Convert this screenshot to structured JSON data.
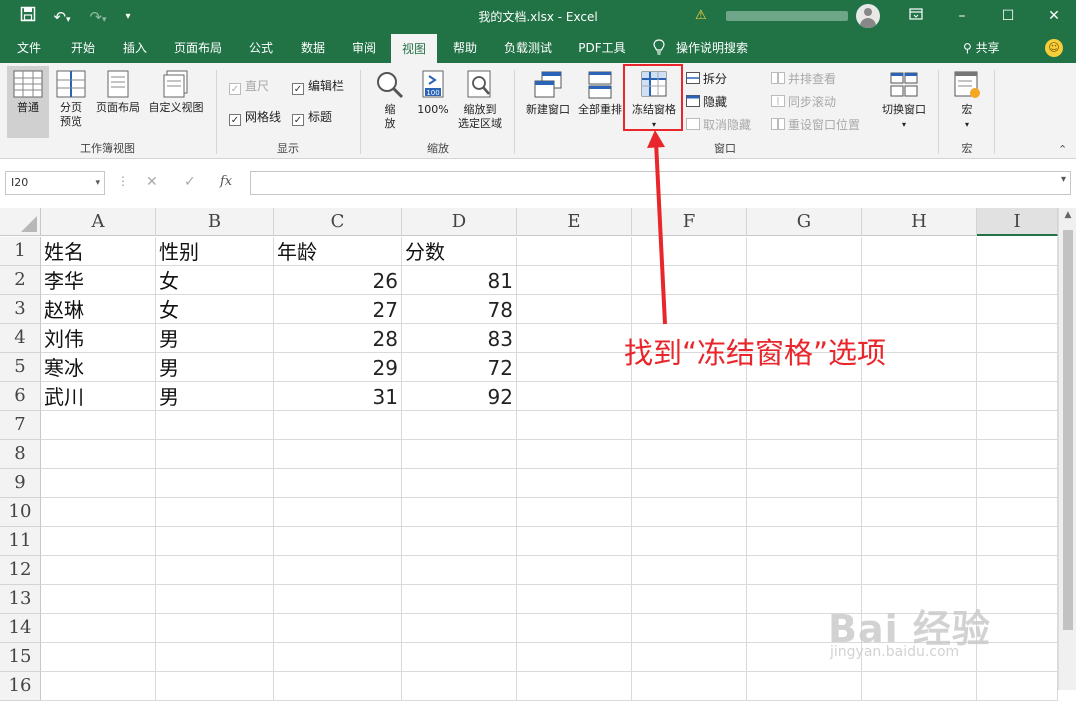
{
  "app": {
    "title": "我的文档.xlsx  -  Excel",
    "accent": "#217346"
  },
  "qat": {
    "save_icon": "save-icon",
    "undo_icon": "undo-icon",
    "redo_icon": "redo-icon",
    "customize_icon": "customize-qat-icon"
  },
  "window": {
    "ribbon_display_icon": "ribbon-display-icon",
    "minimize": "–",
    "maximize": "☐",
    "close": "✕"
  },
  "tabs": [
    "文件",
    "开始",
    "插入",
    "页面布局",
    "公式",
    "数据",
    "审阅",
    "视图",
    "帮助",
    "负载测试",
    "PDF工具",
    "操作说明搜索"
  ],
  "active_tab": "视图",
  "share_label": "共享",
  "ribbon": {
    "workbook_views": {
      "label": "工作簿视图",
      "normal": "普通",
      "page_break_1": "分页",
      "page_break_2": "预览",
      "page_layout": "页面布局",
      "custom_views": "自定义视图"
    },
    "show": {
      "label": "显示",
      "ruler": "直尺",
      "formula_bar": "编辑栏",
      "gridlines": "网格线",
      "headings": "标题"
    },
    "zoom": {
      "label": "缩放",
      "zoom_1": "缩",
      "zoom_2": "放",
      "zoom_100": "100%",
      "zoom_sel_1": "缩放到",
      "zoom_sel_2": "选定区域",
      "icon_100": "100"
    },
    "window": {
      "label": "窗口",
      "new_window": "新建窗口",
      "arrange_all": "全部重排",
      "freeze_panes": "冻结窗格",
      "split": "拆分",
      "hide": "隐藏",
      "unhide": "取消隐藏",
      "side_by_side": "并排查看",
      "sync_scroll": "同步滚动",
      "reset_position": "重设窗口位置",
      "switch_windows": "切换窗口"
    },
    "macros": {
      "label": "宏",
      "macros": "宏"
    }
  },
  "formula_bar": {
    "name_box": "I20",
    "cancel": "✕",
    "enter": "✓",
    "fx": "fx",
    "value": ""
  },
  "columns": [
    "A",
    "B",
    "C",
    "D",
    "E",
    "F",
    "G",
    "H",
    "I"
  ],
  "selected_column": "I",
  "row_numbers": [
    "1",
    "2",
    "3",
    "4",
    "5",
    "6",
    "7",
    "8",
    "9",
    "10",
    "11",
    "12",
    "13",
    "14",
    "15",
    "16"
  ],
  "sheet": {
    "headers": [
      "姓名",
      "性别",
      "年龄",
      "分数"
    ],
    "rows": [
      [
        "李华",
        "女",
        "26",
        "81"
      ],
      [
        "赵琳",
        "女",
        "27",
        "78"
      ],
      [
        "刘伟",
        "男",
        "28",
        "83"
      ],
      [
        "寒冰",
        "男",
        "29",
        "72"
      ],
      [
        "武川",
        "男",
        "31",
        "92"
      ]
    ]
  },
  "annotation": {
    "text": "找到“冻结窗格”选项",
    "color": "#e8262b"
  },
  "watermark": {
    "main": "Bai 经验",
    "sub": "jingyan.baidu.com"
  }
}
